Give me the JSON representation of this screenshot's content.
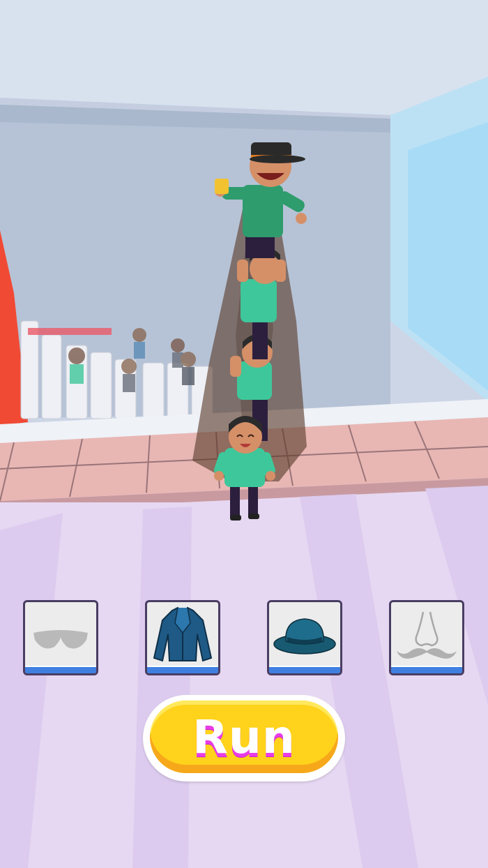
{
  "items": [
    {
      "name": "sunglasses",
      "icon": "sunglasses-icon",
      "state": "locked"
    },
    {
      "name": "jacket",
      "icon": "jacket-icon",
      "state": "unlocked"
    },
    {
      "name": "hat",
      "icon": "fedora-hat-icon",
      "state": "unlocked"
    },
    {
      "name": "mustache",
      "icon": "nose-mustache-icon",
      "state": "locked"
    }
  ],
  "run_button": {
    "label": "Run"
  },
  "colors": {
    "floor": "#e6d8f2",
    "item_bar": "#3f7fe0",
    "run_fill": "#ffd21c",
    "run_text_shadow": "#e93ce6",
    "shirt": "#3ec79a",
    "jacket": "#1f5a86",
    "hat": "#1f6d8c"
  }
}
